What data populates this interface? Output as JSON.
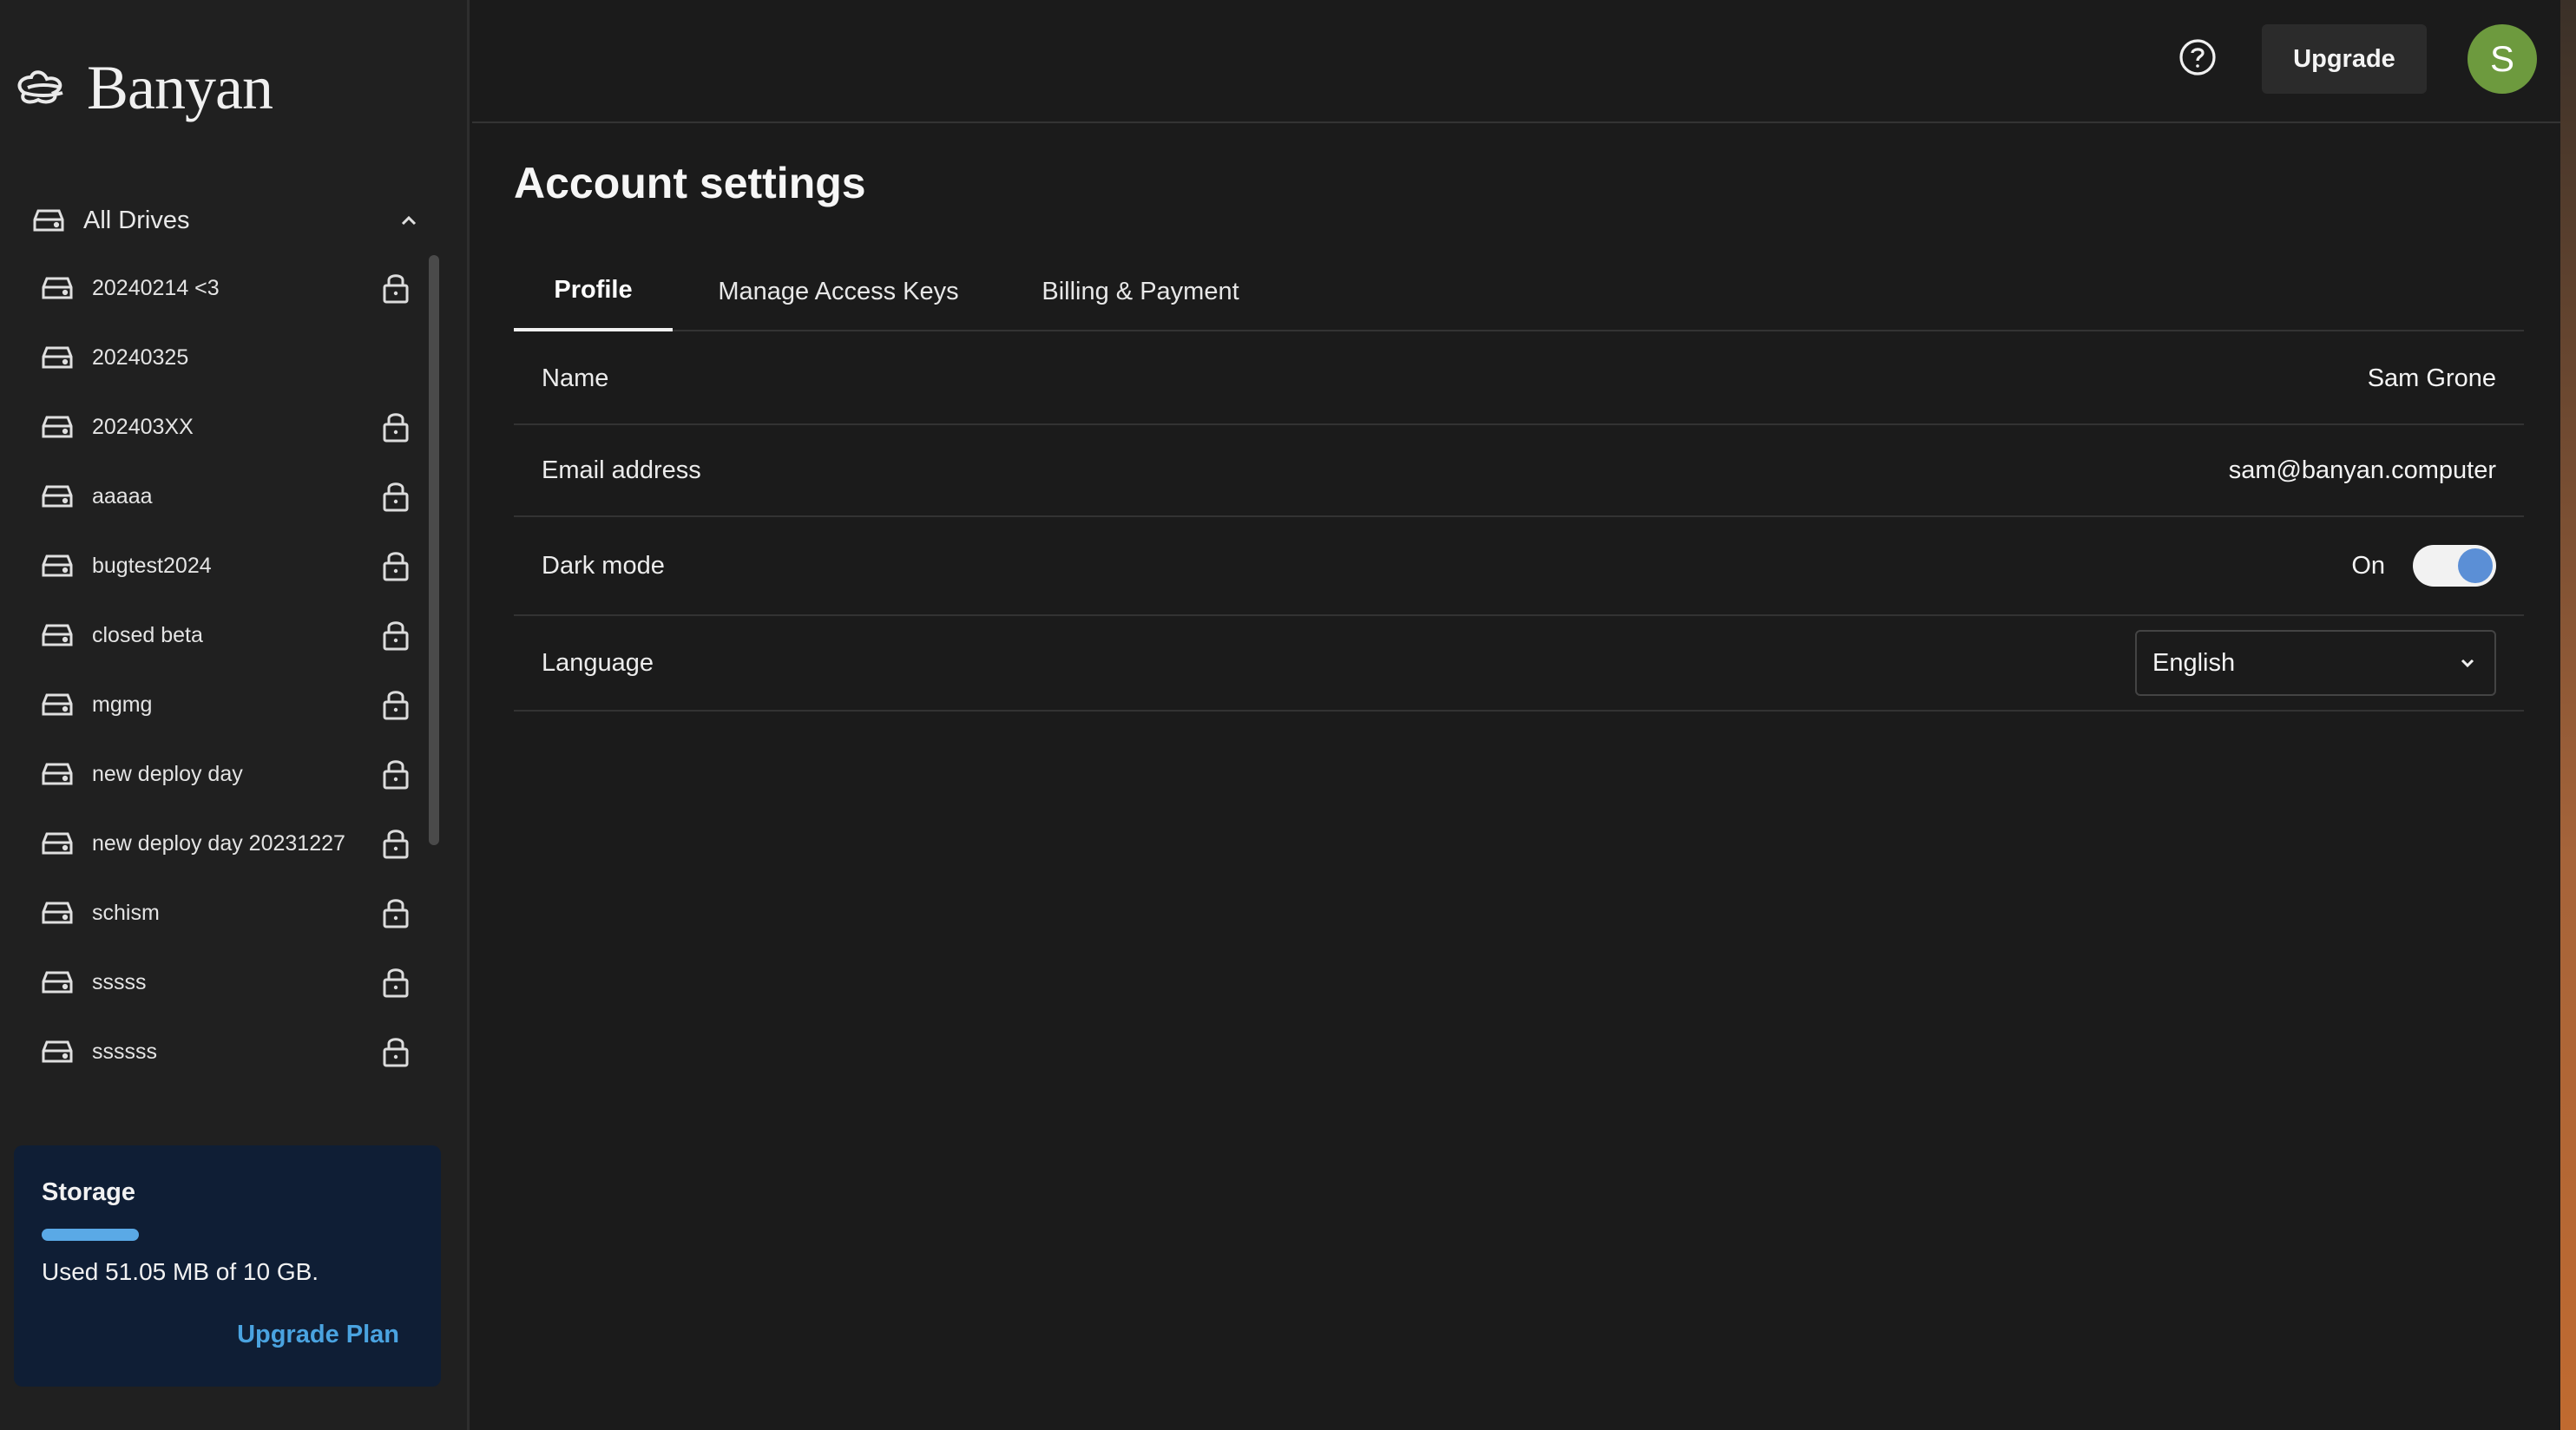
{
  "brand": {
    "name": "Banyan",
    "logo_icon": "banyan-logo-icon"
  },
  "sidebar": {
    "all_drives_label": "All Drives",
    "drives": [
      {
        "name": "20240214 <3",
        "locked": true
      },
      {
        "name": "20240325",
        "locked": false
      },
      {
        "name": "202403XX",
        "locked": true
      },
      {
        "name": "aaaaa",
        "locked": true
      },
      {
        "name": "bugtest2024",
        "locked": true
      },
      {
        "name": "closed beta",
        "locked": true
      },
      {
        "name": "mgmg",
        "locked": true
      },
      {
        "name": "new deploy day",
        "locked": true
      },
      {
        "name": "new deploy day 20231227",
        "locked": true
      },
      {
        "name": "schism",
        "locked": true
      },
      {
        "name": "sssss",
        "locked": true
      },
      {
        "name": "ssssss",
        "locked": true
      }
    ]
  },
  "storage": {
    "title": "Storage",
    "used_fraction": 0.26,
    "used_text": "Used 51.05 MB of 10 GB.",
    "upgrade_label": "Upgrade Plan"
  },
  "header": {
    "upgrade_label": "Upgrade",
    "avatar_initial": "S"
  },
  "main": {
    "title": "Account settings",
    "tabs": [
      {
        "label": "Profile",
        "active": true
      },
      {
        "label": "Manage Access Keys",
        "active": false
      },
      {
        "label": "Billing & Payment",
        "active": false
      }
    ],
    "profile": {
      "name_label": "Name",
      "name_value": "Sam Grone",
      "email_label": "Email address",
      "email_value": "sam@banyan.computer",
      "dark_mode_label": "Dark mode",
      "dark_mode_state": "On",
      "language_label": "Language",
      "language_value": "English"
    }
  },
  "colors": {
    "accent": "#4aa3e0",
    "avatar": "#6d9a3e",
    "toggle_knob": "#5b8fd6"
  }
}
